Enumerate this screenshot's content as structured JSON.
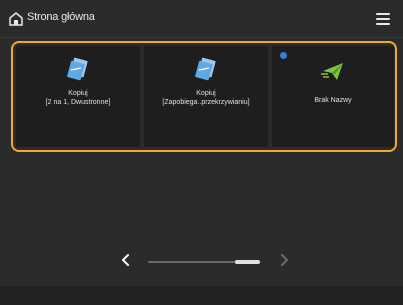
{
  "header": {
    "title": "Strona główna",
    "home_icon": "home-icon",
    "menu_icon": "hamburger-menu-icon"
  },
  "tiles": [
    {
      "line1": "Kopiuj",
      "line2": "[2 na 1, Dwustronne]",
      "icon": "copy-icon"
    },
    {
      "line1": "Kopiuj",
      "line2": "[Zapobiega..przekrzywianiu]",
      "icon": "copy-icon"
    },
    {
      "line1": "Brak Nazwy",
      "line2": "",
      "icon": "send-fax-icon",
      "indicator": "blue-dot"
    }
  ],
  "pager": {
    "prev_icon": "chevron-left-icon",
    "next_icon": "chevron-right-icon"
  },
  "colors": {
    "background": "#2b2b2b",
    "tile": "#1e1e1e",
    "highlight": "#f1a92c",
    "indicator": "#3a7bd5"
  }
}
